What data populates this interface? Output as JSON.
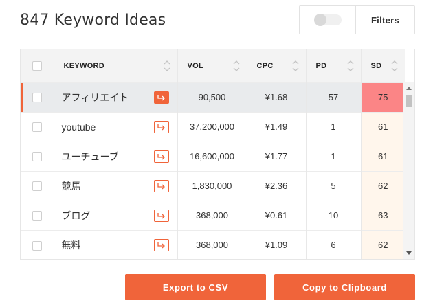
{
  "header": {
    "title": "847 Keyword Ideas",
    "filters_label": "Filters"
  },
  "table": {
    "columns": [
      "KEYWORD",
      "VOL",
      "CPC",
      "PD",
      "SD"
    ],
    "rows": [
      {
        "keyword": "アフィリエイト",
        "vol": "90,500",
        "cpc": "¥1.68",
        "pd": "57",
        "sd": "75",
        "active": true
      },
      {
        "keyword": "youtube",
        "vol": "37,200,000",
        "cpc": "¥1.49",
        "pd": "1",
        "sd": "61"
      },
      {
        "keyword": "ユーチューブ",
        "vol": "16,600,000",
        "cpc": "¥1.77",
        "pd": "1",
        "sd": "61"
      },
      {
        "keyword": "競馬",
        "vol": "1,830,000",
        "cpc": "¥2.36",
        "pd": "5",
        "sd": "62"
      },
      {
        "keyword": "ブログ",
        "vol": "368,000",
        "cpc": "¥0.61",
        "pd": "10",
        "sd": "63"
      },
      {
        "keyword": "無料",
        "vol": "368,000",
        "cpc": "¥1.09",
        "pd": "6",
        "sd": "62"
      }
    ]
  },
  "actions": {
    "export_label": "Export to CSV",
    "copy_label": "Copy to Clipboard"
  },
  "colors": {
    "accent": "#f0643a",
    "sd_high": "#fb8586",
    "sd_mid": "#fff6ec"
  }
}
